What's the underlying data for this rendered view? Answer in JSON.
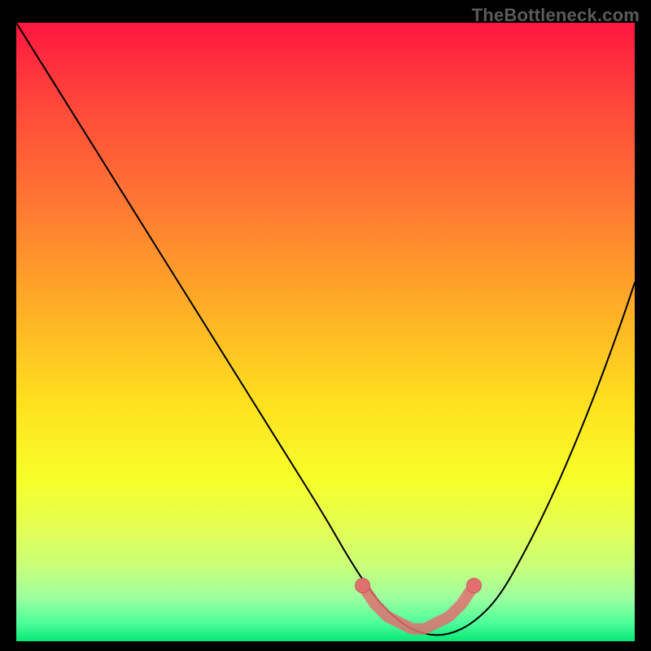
{
  "watermark": "TheBottleneck.com",
  "colors": {
    "frame": "#000000",
    "watermark": "#5b5b5b",
    "curve": "#000000",
    "marker_fill": "#e07070",
    "marker_stroke": "#c85a5a",
    "gradient_stops": [
      {
        "offset": 0.0,
        "color": "#ff1740"
      },
      {
        "offset": 0.14,
        "color": "#ff4a3a"
      },
      {
        "offset": 0.3,
        "color": "#ff7a32"
      },
      {
        "offset": 0.46,
        "color": "#ffae26"
      },
      {
        "offset": 0.62,
        "color": "#ffe21e"
      },
      {
        "offset": 0.74,
        "color": "#f6ff2a"
      },
      {
        "offset": 0.82,
        "color": "#e2ff55"
      },
      {
        "offset": 0.88,
        "color": "#c9ff7a"
      },
      {
        "offset": 0.93,
        "color": "#9cffa0"
      },
      {
        "offset": 0.97,
        "color": "#4eff9a"
      },
      {
        "offset": 1.0,
        "color": "#08e877"
      }
    ]
  },
  "chart_data": {
    "type": "line",
    "title": "",
    "xlabel": "",
    "ylabel": "",
    "xlim": [
      0,
      100
    ],
    "ylim": [
      0,
      100
    ],
    "grid": false,
    "series": [
      {
        "name": "bottleneck-curve",
        "x": [
          0,
          5,
          10,
          15,
          20,
          25,
          30,
          35,
          40,
          45,
          50,
          54,
          58,
          62,
          66,
          70,
          74,
          78,
          82,
          86,
          90,
          94,
          98,
          100
        ],
        "y": [
          100,
          92,
          84,
          76,
          68,
          60,
          52,
          44,
          36,
          28,
          20,
          13,
          7,
          3,
          1,
          1,
          3,
          7,
          14,
          22,
          31,
          41,
          52,
          58
        ]
      }
    ],
    "markers": {
      "name": "optimal-range",
      "x": [
        56,
        58,
        60,
        62,
        64,
        66,
        68,
        70,
        72,
        74
      ],
      "y": [
        9,
        6,
        4,
        3,
        2,
        2,
        3,
        4,
        6,
        9
      ]
    }
  }
}
